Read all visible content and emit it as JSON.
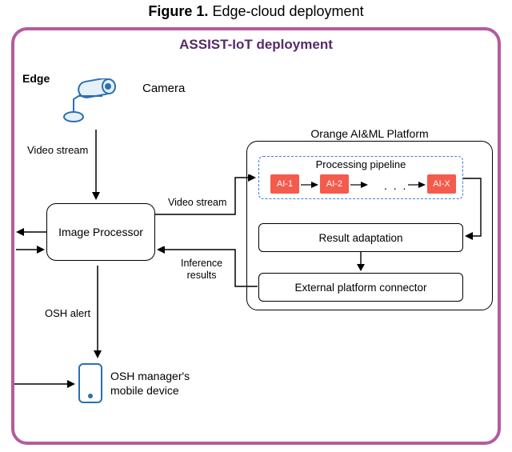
{
  "caption": {
    "label": "Figure 1.",
    "text": "Edge-cloud deployment"
  },
  "title": "ASSIST-IoT deployment",
  "edge_label": "Edge",
  "camera_label": "Camera",
  "labels": {
    "video_stream_1": "Video stream",
    "video_stream_2": "Video stream",
    "inference_line1": "Inference",
    "inference_line2": "results",
    "osh_alert": "OSH alert",
    "mobile_line1": "OSH manager's",
    "mobile_line2": "mobile device"
  },
  "image_processor": "Image Processor",
  "platform": {
    "title": "Orange AI&ML Platform",
    "pipeline_title": "Processing pipeline",
    "ai1": "AI-1",
    "ai2": "AI-2",
    "dots": ". . .",
    "aix": "AI-X",
    "result": "Result adaptation",
    "connector": "External platform connector"
  }
}
